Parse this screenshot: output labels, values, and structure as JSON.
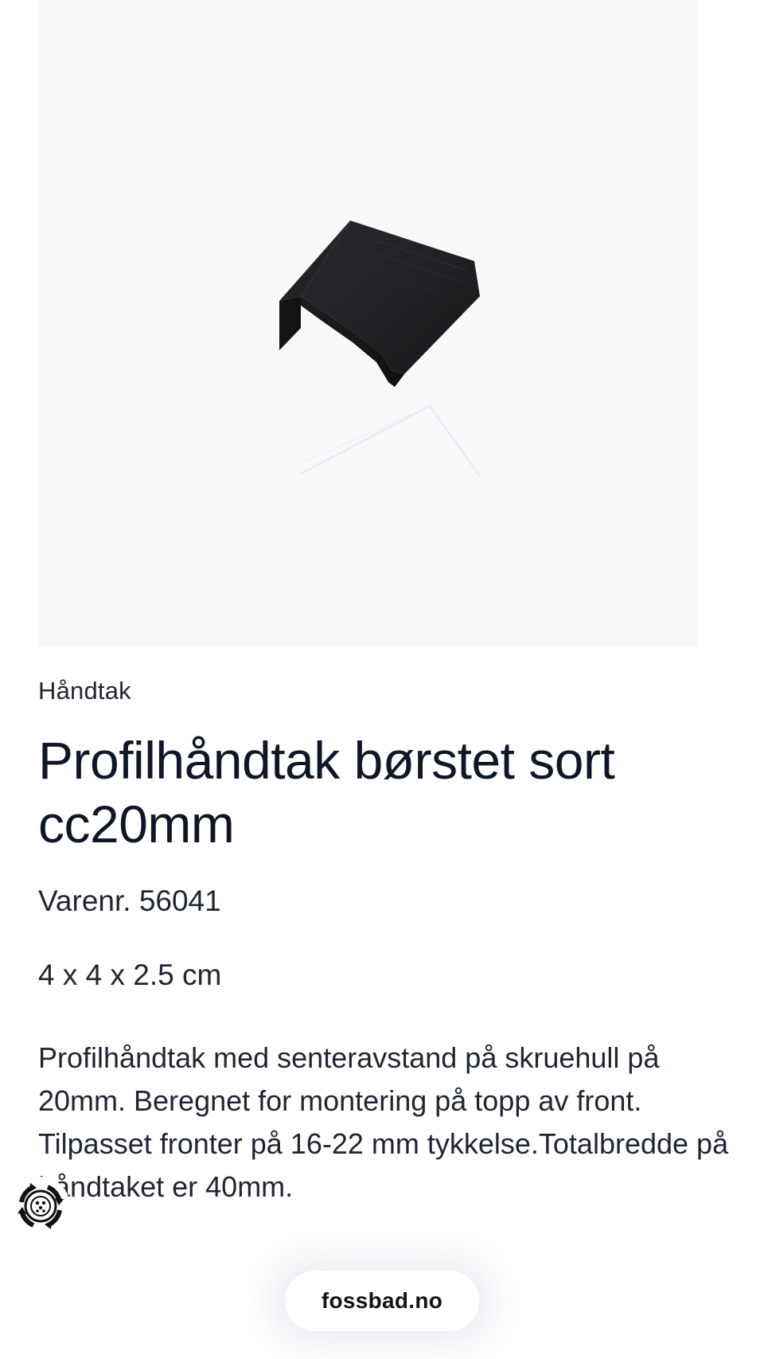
{
  "product": {
    "image_alt": "Profilhåndtak børstet sort",
    "category": "Håndtak",
    "title": "Profilhåndtak børstet sort cc20mm",
    "sku": "Varenr. 56041",
    "dimensions": "4 x 4 x 2.5 cm",
    "description": "Profilhåndtak med senteravstand på skruehull på 20mm. Beregnet for montering på topp av front. Tilpasset fronter på 16-22 mm tykkelse.Totalbredde på håndtaket er 40mm."
  },
  "browser": {
    "domain": "fossbad.no"
  },
  "widget": {
    "icon": "accessibility-icon"
  },
  "colors": {
    "image_background": "#f7f8fa",
    "text": "#121a2b",
    "handle": "#1a1a1d"
  }
}
